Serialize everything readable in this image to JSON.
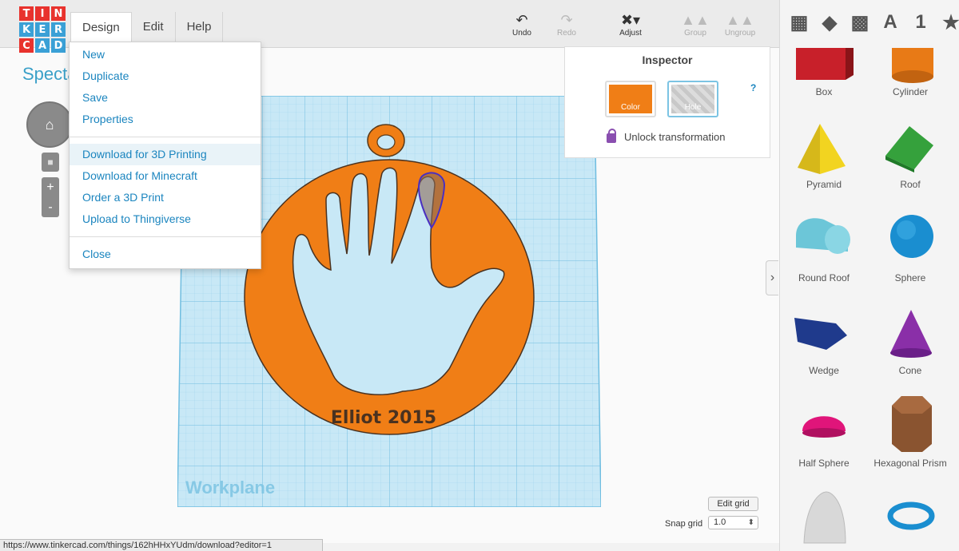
{
  "logo": {
    "letters": [
      "T",
      "I",
      "N",
      "K",
      "E",
      "R",
      "C",
      "A",
      "D"
    ],
    "colors": [
      "#e8322d",
      "#e8322d",
      "#e8322d",
      "#3aa0d6",
      "#3aa0d6",
      "#3aa0d6",
      "#e8322d",
      "#3aa0d6",
      "#3aa0d6"
    ]
  },
  "menubar": {
    "items": [
      "Design",
      "Edit",
      "Help"
    ]
  },
  "toolbar": {
    "undo": "Undo",
    "redo": "Redo",
    "adjust": "Adjust",
    "group": "Group",
    "ungroup": "Ungroup"
  },
  "view_icons": {
    "text_icon": "A",
    "number_icon": "1",
    "star_icon": "★"
  },
  "title": "Specta",
  "design_menu": {
    "group1": [
      "New",
      "Duplicate",
      "Save",
      "Properties"
    ],
    "group2": [
      "Download for 3D Printing",
      "Download for Minecraft",
      "Order a 3D Print",
      "Upload to Thingiverse"
    ],
    "group3": [
      "Close"
    ],
    "highlighted": "Download for 3D Printing"
  },
  "inspector": {
    "title": "Inspector",
    "color_label": "Color",
    "hole_label": "Hole",
    "help": "?",
    "unlock_label": "Unlock transformation",
    "accent": "#f07e16"
  },
  "shapes": [
    "Box",
    "Cylinder",
    "Pyramid",
    "Roof",
    "Round Roof",
    "Sphere",
    "Wedge",
    "Cone",
    "Half Sphere",
    "Hexagonal Prism"
  ],
  "model": {
    "text": "Elliot 2015",
    "color": "#f07e16"
  },
  "workplane": {
    "label": "Workplane"
  },
  "grid_controls": {
    "edit_grid": "Edit grid",
    "snap_label": "Snap grid",
    "snap_value": "1.0"
  },
  "status_url": "https://www.tinkercad.com/things/162hHHxYUdm/download?editor=1"
}
